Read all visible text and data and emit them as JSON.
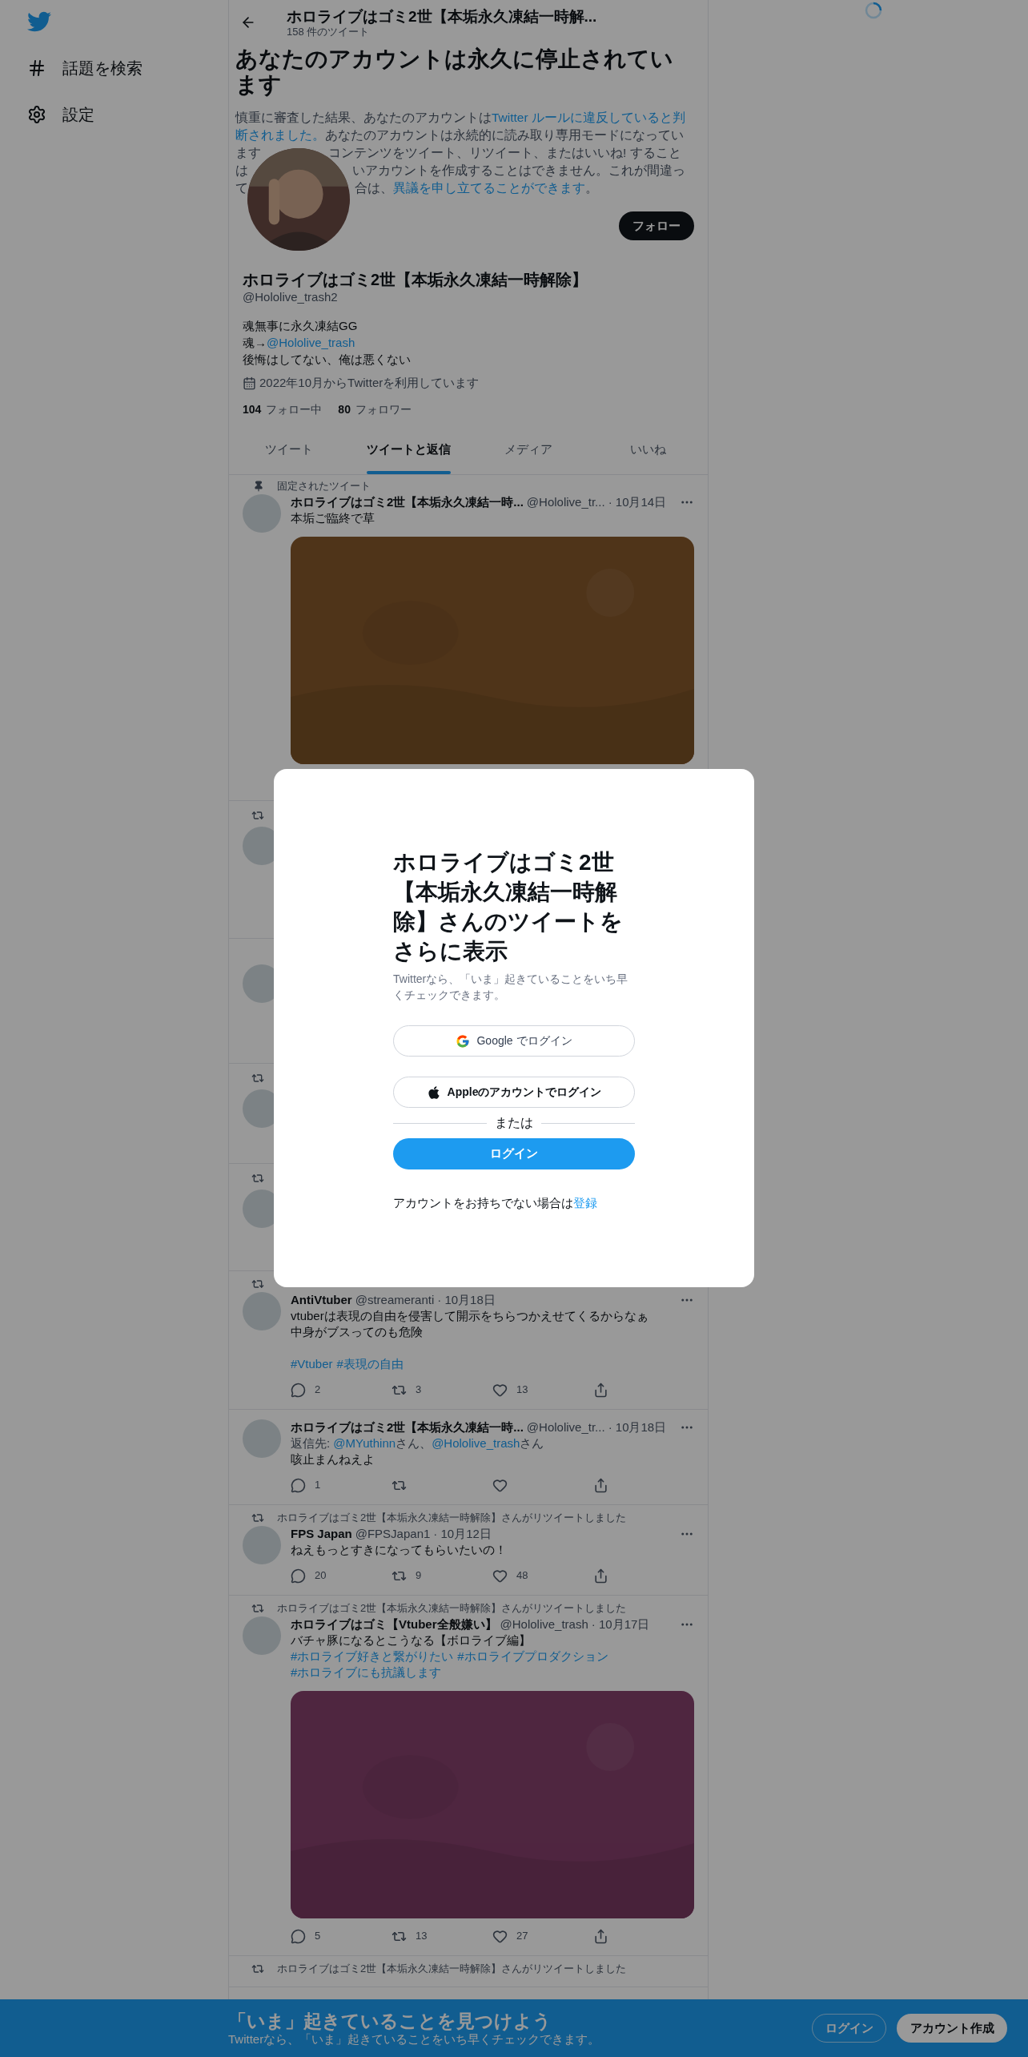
{
  "sidebar": {
    "items": [
      {
        "label": "話題を検索"
      },
      {
        "label": "設定"
      }
    ]
  },
  "header": {
    "title": "ホロライブはゴミ2世【本垢永久凍結一時解...",
    "subtitle": "158 件のツイート"
  },
  "notice": {
    "title": "あなたのアカウントは永久に停止されています",
    "lines": [
      {
        "parts": [
          {
            "text": "慎重に審査した結果、あなたのアカウントは",
            "link": false
          },
          {
            "text": "Twitter ルールに違反していると判",
            "link": true
          }
        ]
      },
      {
        "parts": [
          {
            "text": "断されました。",
            "link": true
          },
          {
            "text": "あなたのアカウントは永続的に読み取り専用モードになってい",
            "link": false
          }
        ]
      },
      {
        "parts": [
          {
            "text": "ます",
            "link": false
          },
          {
            "text": "コンテンツをツイート、リツイート、またはいいね! すること",
            "link": false
          }
        ]
      },
      {
        "parts": [
          {
            "text": "は",
            "link": false
          },
          {
            "text": "いアカウントを作成することはできません。これが間違っ",
            "link": false
          }
        ]
      },
      {
        "parts": [
          {
            "text": "て",
            "link": false
          },
          {
            "text": "合は、",
            "link": false
          },
          {
            "text": "異議を申し立てることができます",
            "link": true
          },
          {
            "text": "。",
            "link": false
          }
        ]
      }
    ]
  },
  "profile": {
    "follow_button": "フォロー",
    "name": "ホロライブはゴミ2世【本垢永久凍結一時解除】",
    "handle": "@Hololive_trash2",
    "bio": [
      {
        "parts": [
          {
            "text": "魂無事に永久凍結GG",
            "link": false
          }
        ]
      },
      {
        "parts": [
          {
            "text": "魂→",
            "link": false
          },
          {
            "text": "@Hololive_trash",
            "link": true
          }
        ]
      },
      {
        "parts": [
          {
            "text": "後悔はしてない、俺は悪くない",
            "link": false
          }
        ]
      }
    ],
    "joined": "2022年10月からTwitterを利用しています",
    "stats": [
      {
        "count": "104",
        "label": "フォロー中"
      },
      {
        "count": "80",
        "label": "フォロワー"
      }
    ]
  },
  "tabs": [
    {
      "label": "ツイート",
      "selected": false
    },
    {
      "label": "ツイートと返信",
      "selected": true
    },
    {
      "label": "メディア",
      "selected": false
    },
    {
      "label": "いいね",
      "selected": false
    }
  ],
  "pinned_tweet": {
    "context": {
      "kind": "pinned",
      "text": "固定されたツイート"
    },
    "name": "ホロライブはゴミ2世【本垢永久凍結一時...",
    "handle": "@Hololive_tr...",
    "date": "· 10月14日",
    "body": "本垢ご臨終で草",
    "media": {
      "kind": "picture"
    }
  },
  "covered_tweets": [
    {
      "retweet": true
    },
    {
      "retweet": false
    },
    {
      "retweet": true
    },
    {
      "retweet": true
    }
  ],
  "tweets": [
    {
      "context": {
        "kind": "retweet"
      },
      "name": "AntiVtuber",
      "handle": "@streameranti",
      "date": "· 10月18日",
      "paragraphs": [
        {
          "lines": [
            "vtuberは表現の自由を侵害して開示をちらつかえせてくるからなぁ",
            "中身がブスってのも危険"
          ]
        },
        {
          "hashtags": [
            "#Vtuber",
            "#表現の自由"
          ]
        }
      ],
      "actions": [
        {
          "kind": "reply",
          "count": "2"
        },
        {
          "kind": "retweet",
          "count": "3"
        },
        {
          "kind": "like",
          "count": "13"
        },
        {
          "kind": "share"
        }
      ]
    },
    {
      "name": "ホロライブはゴミ2世【本垢永久凍結一時...",
      "handle": "@Hololive_tr...",
      "date": "· 10月18日",
      "reply_to": [
        {
          "text": "返信先: ",
          "link": false
        },
        {
          "text": "@MYuthinn",
          "link": true
        },
        {
          "text": "さん、",
          "link": false
        },
        {
          "text": "@Hololive_trash",
          "link": true
        },
        {
          "text": "さん",
          "link": false
        }
      ],
      "paragraphs": [
        {
          "lines": [
            "咳止まんねえよ"
          ]
        }
      ],
      "actions": [
        {
          "kind": "reply",
          "count": "1"
        },
        {
          "kind": "retweet"
        },
        {
          "kind": "like"
        },
        {
          "kind": "share"
        }
      ]
    },
    {
      "context": {
        "kind": "retweet",
        "text": "ホロライブはゴミ2世【本垢永久凍結一時解除】さんがリツイートしました"
      },
      "name": "FPS Japan",
      "handle": "@FPSJapan1",
      "date": "· 10月12日",
      "paragraphs": [
        {
          "lines": [
            "ねえもっとすきになってもらいたいの！"
          ]
        }
      ],
      "actions": [
        {
          "kind": "reply",
          "count": "20"
        },
        {
          "kind": "retweet",
          "count": "9"
        },
        {
          "kind": "like",
          "count": "48"
        },
        {
          "kind": "share"
        }
      ]
    },
    {
      "context": {
        "kind": "retweet",
        "text": "ホロライブはゴミ2世【本垢永久凍結一時解除】さんがリツイートしました"
      },
      "name": "ホロライブはゴミ【Vtuber全般嫌い】",
      "handle": "@Hololive_trash",
      "date": "· 10月17日",
      "paragraphs": [
        {
          "lines": [
            "バチャ豚になるとこうなる【ボロライブ編】"
          ],
          "hashtags": [
            "#ホロライブ好きと繋がりたい",
            "#ホロライブプロダクション",
            "#ホロライブにも抗議します"
          ]
        }
      ],
      "media": {
        "kind": "picture"
      },
      "actions": [
        {
          "kind": "reply",
          "count": "5"
        },
        {
          "kind": "retweet",
          "count": "13"
        },
        {
          "kind": "like",
          "count": "27"
        },
        {
          "kind": "share"
        }
      ]
    },
    {
      "context": {
        "kind": "retweet",
        "text": "ホロライブはゴミ2世【本垢永久凍結一時解除】さんがリツイートしました"
      }
    }
  ],
  "modal": {
    "title": "ホロライブはゴミ2世【本垢永久凍結一時解除】さんのツイートをさらに表示",
    "subtitle": "Twitterなら、「いま」起きていることをいち早くチェックできます。",
    "buttons": [
      {
        "kind": "google",
        "label": "Google でログイン"
      },
      {
        "kind": "apple",
        "label": "Appleのアカウントでログイン"
      }
    ],
    "divider": "または",
    "login": "ログイン",
    "footer": {
      "text": "アカウントをお持ちでない場合は",
      "link": "登録"
    }
  },
  "bottom_bar": {
    "title": "「いま」起きていることを見つけよう",
    "subtitle": "Twitterなら、「いま」起きていることをいち早くチェックできます。",
    "login": "ログイン",
    "signup": "アカウント作成"
  }
}
